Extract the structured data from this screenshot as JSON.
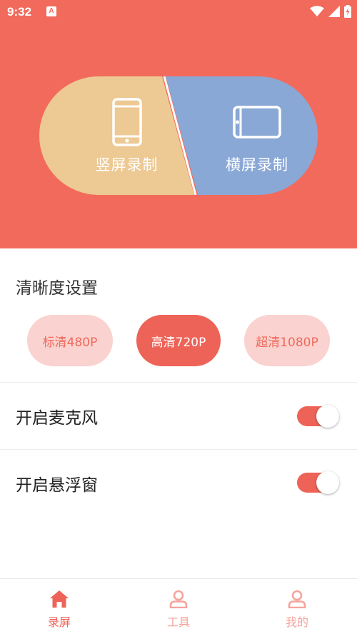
{
  "status_bar": {
    "time": "9:32",
    "notification_icon": "A"
  },
  "record_modes": {
    "portrait_label": "竖屏录制",
    "landscape_label": "横屏录制"
  },
  "clarity": {
    "title": "清晰度设置",
    "options": [
      "标清480P",
      "高清720P",
      "超清1080P"
    ],
    "selected": "高清720P"
  },
  "settings": {
    "microphone_label": "开启麦克风",
    "microphone_on": true,
    "floating_window_label": "开启悬浮窗",
    "floating_window_on": true
  },
  "bottom_nav": {
    "items": [
      {
        "label": "录屏",
        "icon": "home-icon",
        "active": true
      },
      {
        "label": "工具",
        "icon": "person-icon",
        "active": false
      },
      {
        "label": "我的",
        "icon": "person-icon",
        "active": false
      }
    ]
  },
  "colors": {
    "accent": "#f26a5c",
    "portrait_half": "#edc993",
    "landscape_half": "#8aa8d6",
    "chip_light": "#fad2cf",
    "chip_selected": "#ee6357"
  }
}
